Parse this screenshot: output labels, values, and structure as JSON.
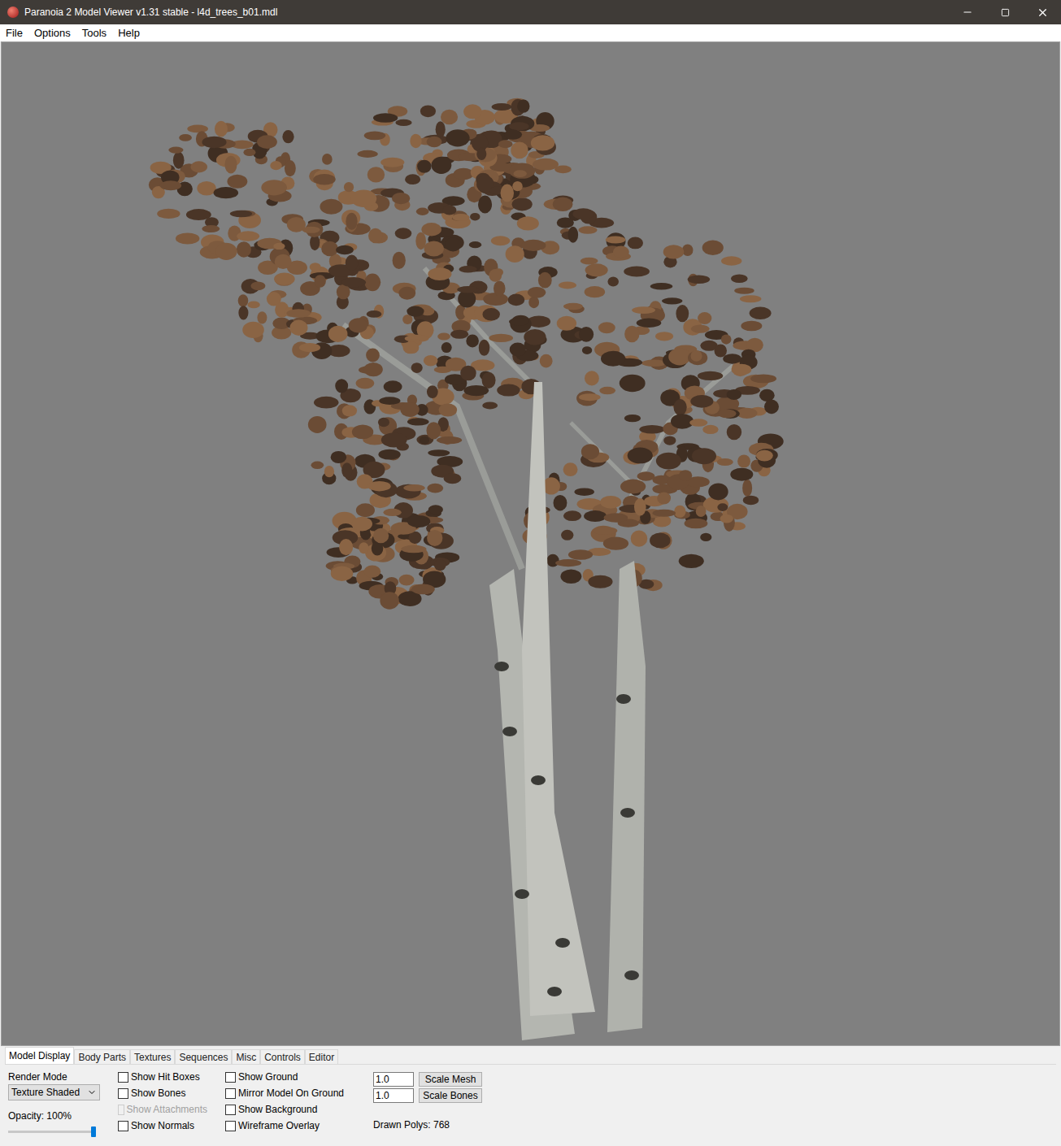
{
  "window": {
    "title": "Paranoia 2 Model Viewer v1.31 stable - l4d_trees_b01.mdl"
  },
  "menu": [
    "File",
    "Options",
    "Tools",
    "Help"
  ],
  "tabs": [
    {
      "label": "Model Display",
      "selected": true
    },
    {
      "label": "Body Parts",
      "selected": false
    },
    {
      "label": "Textures",
      "selected": false
    },
    {
      "label": "Sequences",
      "selected": false
    },
    {
      "label": "Misc",
      "selected": false
    },
    {
      "label": "Controls",
      "selected": false
    },
    {
      "label": "Editor",
      "selected": false
    }
  ],
  "render_mode": {
    "label": "Render Mode",
    "value": "Texture Shaded"
  },
  "opacity": {
    "label": "Opacity: 100%",
    "level": 1.0
  },
  "checkbox_columns": [
    [
      {
        "label": "Show Hit Boxes",
        "checked": false,
        "disabled": false
      },
      {
        "label": "Show Bones",
        "checked": false,
        "disabled": false
      },
      {
        "label": "Show Attachments",
        "checked": false,
        "disabled": true
      },
      {
        "label": "Show Normals",
        "checked": false,
        "disabled": false
      }
    ],
    [
      {
        "label": "Show Ground",
        "checked": false,
        "disabled": false
      },
      {
        "label": "Mirror Model On Ground",
        "checked": false,
        "disabled": false
      },
      {
        "label": "Show Background",
        "checked": false,
        "disabled": false
      },
      {
        "label": "Wireframe Overlay",
        "checked": false,
        "disabled": false
      }
    ]
  ],
  "scale": [
    {
      "value": "1.0",
      "button": "Scale Mesh"
    },
    {
      "value": "1.0",
      "button": "Scale Bones"
    }
  ],
  "status": "Drawn Polys: 768"
}
